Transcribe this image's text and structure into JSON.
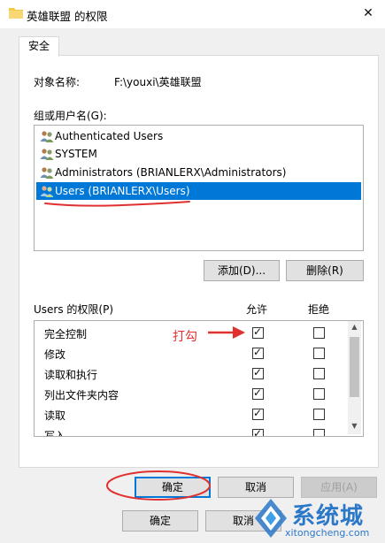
{
  "window": {
    "title": "英雄联盟 的权限",
    "close_glyph": "✕"
  },
  "tabs": [
    {
      "label": "安全"
    }
  ],
  "object": {
    "label": "对象名称:",
    "value": "F:\\youxi\\英雄联盟"
  },
  "groups": {
    "label": "组或用户名(G):",
    "items": [
      {
        "name": "Authenticated Users",
        "selected": false
      },
      {
        "name": "SYSTEM",
        "selected": false
      },
      {
        "name": "Administrators (BRIANLERX\\Administrators)",
        "selected": false
      },
      {
        "name": "Users (BRIANLERX\\Users)",
        "selected": true
      }
    ]
  },
  "buttons": {
    "add": "添加(D)...",
    "remove": "删除(R)",
    "ok": "确定",
    "cancel": "取消",
    "apply": "应用(A)"
  },
  "permissions": {
    "label": "Users 的权限(P)",
    "allow_header": "允许",
    "deny_header": "拒绝",
    "rows": [
      {
        "name": "完全控制",
        "allow": true,
        "deny": false
      },
      {
        "name": "修改",
        "allow": true,
        "deny": false
      },
      {
        "name": "读取和执行",
        "allow": true,
        "deny": false
      },
      {
        "name": "列出文件夹内容",
        "allow": true,
        "deny": false
      },
      {
        "name": "读取",
        "allow": true,
        "deny": false
      },
      {
        "name": "写入",
        "allow": true,
        "deny": false
      }
    ]
  },
  "annotation": {
    "text": "打勾",
    "color": "#e03030"
  },
  "background_window": {
    "ok": "确定",
    "cancel": "取消"
  },
  "watermark": {
    "main": "系统城",
    "url": "xitongcheng.com"
  },
  "colors": {
    "selection": "#0078d7",
    "annotation": "#e03030",
    "watermark": "#2c78c8"
  }
}
